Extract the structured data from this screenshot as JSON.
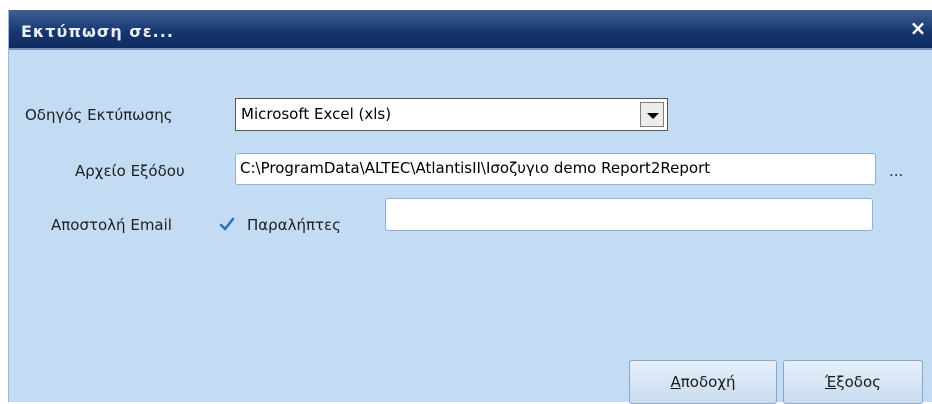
{
  "window": {
    "title": "Εκτύπωση σε...",
    "close_symbol": "×"
  },
  "form": {
    "driver_label": "Οδηγός Εκτύπωσης",
    "driver_value": "Microsoft Excel (xls)",
    "output_label": "Αρχείο Εξόδου",
    "output_value": "C:\\ProgramData\\ALTEC\\AtlantisII\\Ισοζυγιο demo Report2Report",
    "browse_label": "...",
    "email_label": "Αποστολή Email",
    "email_checked": true,
    "recipients_label": "Παραλήπτες",
    "recipients_value": ""
  },
  "buttons": {
    "accept_first": "Α",
    "accept_rest": "ποδοχή",
    "exit_first": "Έ",
    "exit_rest": "ξοδος"
  },
  "colors": {
    "title_bar": "#16366e",
    "dialog_bg": "#c3dbf3",
    "check": "#2f6db5"
  }
}
